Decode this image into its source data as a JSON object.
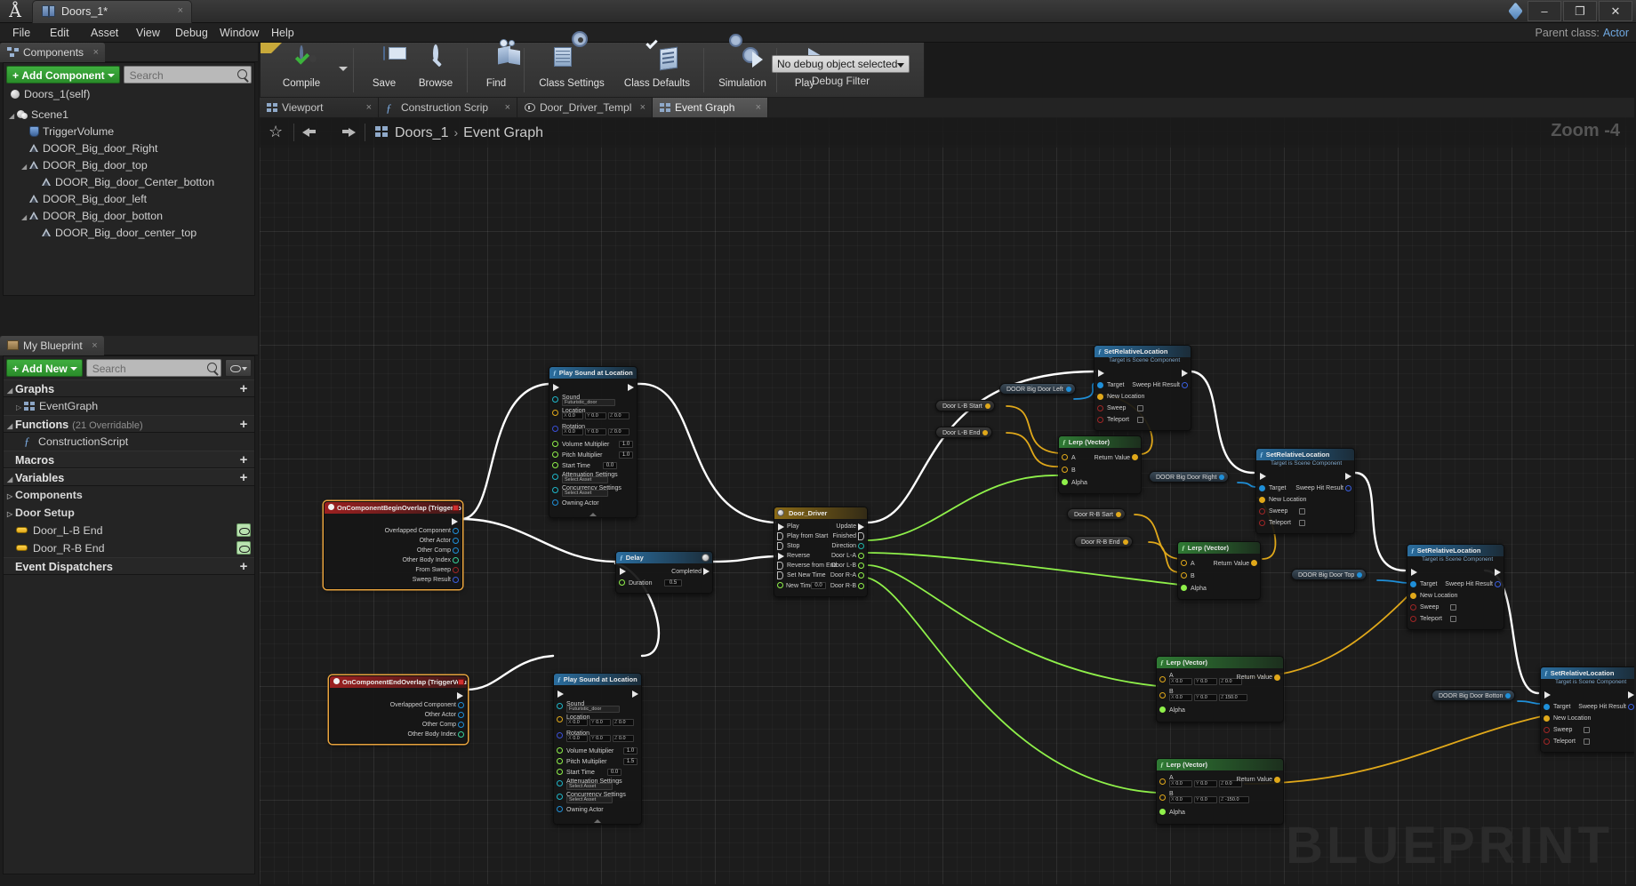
{
  "window": {
    "app_icon": "unreal-logo-icon",
    "document_tab": "Doors_1*",
    "minimize": "–",
    "maximize": "❐",
    "close": "✕",
    "parent_class_label": "Parent class:",
    "parent_class_value": "Actor"
  },
  "menu": {
    "items": [
      "File",
      "Edit",
      "Asset",
      "View",
      "Debug",
      "Window",
      "Help"
    ]
  },
  "components_panel": {
    "tab_label": "Components",
    "tab_close": "×",
    "add_button": "Add Component",
    "search_placeholder": "Search",
    "root": "Doors_1(self)",
    "tree": [
      {
        "label": "Scene1",
        "depth": 0,
        "arrow": "◢",
        "icon": "scene-icon"
      },
      {
        "label": "TriggerVolume",
        "depth": 1,
        "arrow": "",
        "icon": "shield-icon"
      },
      {
        "label": "DOOR_Big_door_Right",
        "depth": 1,
        "arrow": "",
        "icon": "mesh-icon"
      },
      {
        "label": "DOOR_Big_door_top",
        "depth": 1,
        "arrow": "◢",
        "icon": "mesh-icon"
      },
      {
        "label": "DOOR_Big_door_Center_botton",
        "depth": 2,
        "arrow": "",
        "icon": "mesh-icon"
      },
      {
        "label": "DOOR_Big_door_left",
        "depth": 1,
        "arrow": "",
        "icon": "mesh-icon"
      },
      {
        "label": "DOOR_Big_door_botton",
        "depth": 1,
        "arrow": "◢",
        "icon": "mesh-icon"
      },
      {
        "label": "DOOR_Big_door_center_top",
        "depth": 2,
        "arrow": "",
        "icon": "mesh-icon"
      }
    ]
  },
  "myblueprint_panel": {
    "tab_label": "My Blueprint",
    "tab_close": "×",
    "add_button": "Add New",
    "search_placeholder": "Search",
    "sections": [
      {
        "name": "Graphs",
        "arrow": "◢",
        "plus": "+",
        "items": [
          {
            "label": "EventGraph",
            "icon": "graph-icon",
            "arrow": "▷"
          }
        ]
      },
      {
        "name": "Functions",
        "sub": "(21 Overridable)",
        "arrow": "◢",
        "plus": "+",
        "items": [
          {
            "label": "ConstructionScript",
            "icon": "function-icon",
            "arrow": ""
          }
        ]
      },
      {
        "name": "Macros",
        "arrow": "",
        "plus": "+",
        "items": []
      },
      {
        "name": "Variables",
        "arrow": "◢",
        "plus": "+",
        "categories": [
          {
            "label": "Components",
            "arrow": "▷"
          },
          {
            "label": "Door Setup",
            "arrow": "▷"
          }
        ],
        "variables": [
          {
            "label": "Door_L-B End",
            "type_color": "#e0a81a",
            "visibility": "eye-icon"
          },
          {
            "label": "Door_R-B End",
            "type_color": "#e0a81a",
            "visibility": "eye-icon"
          }
        ]
      },
      {
        "name": "Event Dispatchers",
        "arrow": "",
        "plus": "+",
        "items": []
      }
    ]
  },
  "toolbar": {
    "buttons": [
      {
        "label": "Compile",
        "icon": "compile-gear-check-icon",
        "has_dropdown": true
      },
      {
        "label": "Save",
        "icon": "save-disk-icon"
      },
      {
        "label": "Browse",
        "icon": "browse-magnifier-icon"
      },
      {
        "label": "Find",
        "icon": "find-icon"
      },
      {
        "label": "Class Settings",
        "icon": "class-settings-icon"
      },
      {
        "label": "Class Defaults",
        "icon": "class-defaults-icon"
      },
      {
        "label": "Simulation",
        "icon": "simulation-icon"
      },
      {
        "label": "Play",
        "icon": "play-icon",
        "has_dropdown": true
      }
    ],
    "debug_object": "No debug object selected",
    "debug_filter_label": "Debug Filter"
  },
  "graph_tabs": [
    {
      "label": "Viewport",
      "icon": "viewport-icon",
      "active": false
    },
    {
      "label": "Construction Scrip",
      "icon": "function-icon",
      "active": false
    },
    {
      "label": "Door_Driver_Templ",
      "icon": "timeline-clock-icon",
      "active": false
    },
    {
      "label": "Event Graph",
      "icon": "graph-icon",
      "active": true
    }
  ],
  "graph_header": {
    "favorite_icon": "star-icon",
    "back_icon": "back-arrow-icon",
    "forward_icon": "forward-arrow-icon",
    "breadcrumb_icon": "graph-icon",
    "breadcrumb_root": "Doors_1",
    "breadcrumb_sep": "›",
    "breadcrumb_leaf": "Event Graph",
    "zoom": "Zoom -4",
    "watermark": "BLUEPRINT"
  },
  "nodes": {
    "begin_overlap": {
      "title": "OnComponentBeginOverlap (TriggerVolume)",
      "outputs": [
        "Overlapped Component",
        "Other Actor",
        "Other Comp",
        "Other Body Index",
        "From Sweep",
        "Sweep Result"
      ]
    },
    "end_overlap": {
      "title": "OnComponentEndOverlap (TriggerVolume)",
      "outputs": [
        "Overlapped Component",
        "Other Actor",
        "Other Comp",
        "Other Body Index"
      ]
    },
    "play_sound_1": {
      "title": "Play Sound at Location",
      "sound_label": "Sound",
      "sound_value": "Futuristic_door",
      "location_label": "Location",
      "location": [
        "0.0",
        "0.0",
        "0.0"
      ],
      "rotation_label": "Rotation",
      "rotation": [
        "0.0",
        "0.0",
        "0.0"
      ],
      "volume_label": "Volume Multiplier",
      "volume": "1.0",
      "pitch_label": "Pitch Multiplier",
      "pitch": "1.0",
      "starttime_label": "Start Time",
      "starttime": "0.0",
      "atten_label": "Attenuation Settings",
      "atten_value": "Select Asset",
      "conc_label": "Concurrency Settings",
      "conc_value": "Select Asset",
      "owning_label": "Owning Actor"
    },
    "play_sound_2": {
      "title": "Play Sound at Location",
      "sound_label": "Sound",
      "sound_value": "Futuristic_door",
      "location_label": "Location",
      "location": [
        "0.0",
        "0.0",
        "0.0"
      ],
      "rotation_label": "Rotation",
      "rotation": [
        "0.0",
        "0.0",
        "0.0"
      ],
      "volume_label": "Volume Multiplier",
      "volume": "1.0",
      "pitch_label": "Pitch Multiplier",
      "pitch": "1.5",
      "starttime_label": "Start Time",
      "starttime": "0.0",
      "atten_label": "Attenuation Settings",
      "atten_value": "Select Asset",
      "conc_label": "Concurrency Settings",
      "conc_value": "Select Asset",
      "owning_label": "Owning Actor"
    },
    "delay": {
      "title": "Delay",
      "duration_label": "Duration",
      "duration": "0.5",
      "completed_label": "Completed"
    },
    "door_driver": {
      "title": "Door_Driver",
      "inputs": [
        "Play",
        "Play from Start",
        "Stop",
        "Reverse",
        "Reverse from End",
        "Set New Time"
      ],
      "new_time_label": "New Time",
      "new_time": "0.0",
      "outputs": [
        "Update",
        "Finished",
        "Direction",
        "Door L-A",
        "Door L-B",
        "Door R-A",
        "Door R-B"
      ]
    },
    "lerps": [
      {
        "title": "Lerp (Vector)",
        "a_label": "A",
        "b_label": "B",
        "alpha_label": "Alpha",
        "return_label": "Return Value",
        "a": null,
        "b": null
      },
      {
        "title": "Lerp (Vector)",
        "a_label": "A",
        "b_label": "B",
        "alpha_label": "Alpha",
        "return_label": "Return Value",
        "a": null,
        "b": null
      },
      {
        "title": "Lerp (Vector)",
        "a_label": "A",
        "b_label": "B",
        "alpha_label": "Alpha",
        "return_label": "Return Value",
        "a": [
          "0.0",
          "0.0",
          "0.0"
        ],
        "b": [
          "0.0",
          "0.0",
          "150.0"
        ]
      },
      {
        "title": "Lerp (Vector)",
        "a_label": "A",
        "b_label": "B",
        "alpha_label": "Alpha",
        "return_label": "Return Value",
        "a": [
          "0.0",
          "0.0",
          "0.0"
        ],
        "b": [
          "0.0",
          "0.0",
          "-150.0"
        ]
      }
    ],
    "set_relative_location": {
      "title": "SetRelativeLocation",
      "subtitle": "Target is Scene Component",
      "target_label": "Target",
      "new_location_label": "New Location",
      "sweep_label": "Sweep",
      "teleport_label": "Teleport",
      "sweep_hit_label": "Sweep Hit Result"
    },
    "variable_getters": [
      {
        "label": "Door L-B Start",
        "kind": "vector"
      },
      {
        "label": "Door L-B End",
        "kind": "vector"
      },
      {
        "label": "Door R-B Sart",
        "kind": "vector"
      },
      {
        "label": "Door R-B End",
        "kind": "vector"
      }
    ],
    "component_getters": [
      {
        "label": "DOOR Big Door Left",
        "kind": "component"
      },
      {
        "label": "DOOR Big Door Right",
        "kind": "component"
      },
      {
        "label": "DOOR Big Door Top",
        "kind": "component"
      },
      {
        "label": "DOOR Big Door Botton",
        "kind": "component"
      }
    ]
  },
  "colors": {
    "accent_green": "#2f9a2f",
    "exec_wire": "#ffffff",
    "vector_wire": "#e0a81a",
    "float_wire": "#8ff04a",
    "object_wire": "#1f8fd8",
    "node_fn_header": "#2a6d9e",
    "node_pure_header": "#2f7a34",
    "node_event_header": "#9c2020",
    "parent_class_link": "#6fa8e0"
  }
}
